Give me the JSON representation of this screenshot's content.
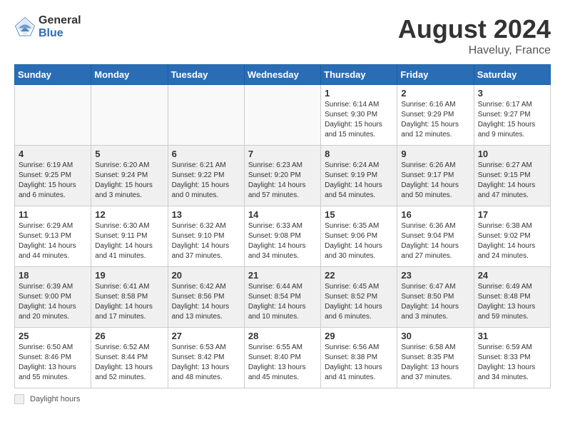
{
  "header": {
    "logo_general": "General",
    "logo_blue": "Blue",
    "month_year": "August 2024",
    "location": "Haveluy, France"
  },
  "days_of_week": [
    "Sunday",
    "Monday",
    "Tuesday",
    "Wednesday",
    "Thursday",
    "Friday",
    "Saturday"
  ],
  "footer": {
    "legend_label": "Daylight hours"
  },
  "weeks": [
    [
      {
        "day": "",
        "empty": true
      },
      {
        "day": "",
        "empty": true
      },
      {
        "day": "",
        "empty": true
      },
      {
        "day": "",
        "empty": true
      },
      {
        "day": "1",
        "sunrise": "6:14 AM",
        "sunset": "9:30 PM",
        "daylight": "15 hours and 15 minutes."
      },
      {
        "day": "2",
        "sunrise": "6:16 AM",
        "sunset": "9:29 PM",
        "daylight": "15 hours and 12 minutes."
      },
      {
        "day": "3",
        "sunrise": "6:17 AM",
        "sunset": "9:27 PM",
        "daylight": "15 hours and 9 minutes."
      }
    ],
    [
      {
        "day": "4",
        "sunrise": "6:19 AM",
        "sunset": "9:25 PM",
        "daylight": "15 hours and 6 minutes."
      },
      {
        "day": "5",
        "sunrise": "6:20 AM",
        "sunset": "9:24 PM",
        "daylight": "15 hours and 3 minutes."
      },
      {
        "day": "6",
        "sunrise": "6:21 AM",
        "sunset": "9:22 PM",
        "daylight": "15 hours and 0 minutes."
      },
      {
        "day": "7",
        "sunrise": "6:23 AM",
        "sunset": "9:20 PM",
        "daylight": "14 hours and 57 minutes."
      },
      {
        "day": "8",
        "sunrise": "6:24 AM",
        "sunset": "9:19 PM",
        "daylight": "14 hours and 54 minutes."
      },
      {
        "day": "9",
        "sunrise": "6:26 AM",
        "sunset": "9:17 PM",
        "daylight": "14 hours and 50 minutes."
      },
      {
        "day": "10",
        "sunrise": "6:27 AM",
        "sunset": "9:15 PM",
        "daylight": "14 hours and 47 minutes."
      }
    ],
    [
      {
        "day": "11",
        "sunrise": "6:29 AM",
        "sunset": "9:13 PM",
        "daylight": "14 hours and 44 minutes."
      },
      {
        "day": "12",
        "sunrise": "6:30 AM",
        "sunset": "9:11 PM",
        "daylight": "14 hours and 41 minutes."
      },
      {
        "day": "13",
        "sunrise": "6:32 AM",
        "sunset": "9:10 PM",
        "daylight": "14 hours and 37 minutes."
      },
      {
        "day": "14",
        "sunrise": "6:33 AM",
        "sunset": "9:08 PM",
        "daylight": "14 hours and 34 minutes."
      },
      {
        "day": "15",
        "sunrise": "6:35 AM",
        "sunset": "9:06 PM",
        "daylight": "14 hours and 30 minutes."
      },
      {
        "day": "16",
        "sunrise": "6:36 AM",
        "sunset": "9:04 PM",
        "daylight": "14 hours and 27 minutes."
      },
      {
        "day": "17",
        "sunrise": "6:38 AM",
        "sunset": "9:02 PM",
        "daylight": "14 hours and 24 minutes."
      }
    ],
    [
      {
        "day": "18",
        "sunrise": "6:39 AM",
        "sunset": "9:00 PM",
        "daylight": "14 hours and 20 minutes."
      },
      {
        "day": "19",
        "sunrise": "6:41 AM",
        "sunset": "8:58 PM",
        "daylight": "14 hours and 17 minutes."
      },
      {
        "day": "20",
        "sunrise": "6:42 AM",
        "sunset": "8:56 PM",
        "daylight": "14 hours and 13 minutes."
      },
      {
        "day": "21",
        "sunrise": "6:44 AM",
        "sunset": "8:54 PM",
        "daylight": "14 hours and 10 minutes."
      },
      {
        "day": "22",
        "sunrise": "6:45 AM",
        "sunset": "8:52 PM",
        "daylight": "14 hours and 6 minutes."
      },
      {
        "day": "23",
        "sunrise": "6:47 AM",
        "sunset": "8:50 PM",
        "daylight": "14 hours and 3 minutes."
      },
      {
        "day": "24",
        "sunrise": "6:49 AM",
        "sunset": "8:48 PM",
        "daylight": "13 hours and 59 minutes."
      }
    ],
    [
      {
        "day": "25",
        "sunrise": "6:50 AM",
        "sunset": "8:46 PM",
        "daylight": "13 hours and 55 minutes."
      },
      {
        "day": "26",
        "sunrise": "6:52 AM",
        "sunset": "8:44 PM",
        "daylight": "13 hours and 52 minutes."
      },
      {
        "day": "27",
        "sunrise": "6:53 AM",
        "sunset": "8:42 PM",
        "daylight": "13 hours and 48 minutes."
      },
      {
        "day": "28",
        "sunrise": "6:55 AM",
        "sunset": "8:40 PM",
        "daylight": "13 hours and 45 minutes."
      },
      {
        "day": "29",
        "sunrise": "6:56 AM",
        "sunset": "8:38 PM",
        "daylight": "13 hours and 41 minutes."
      },
      {
        "day": "30",
        "sunrise": "6:58 AM",
        "sunset": "8:35 PM",
        "daylight": "13 hours and 37 minutes."
      },
      {
        "day": "31",
        "sunrise": "6:59 AM",
        "sunset": "8:33 PM",
        "daylight": "13 hours and 34 minutes."
      }
    ]
  ]
}
